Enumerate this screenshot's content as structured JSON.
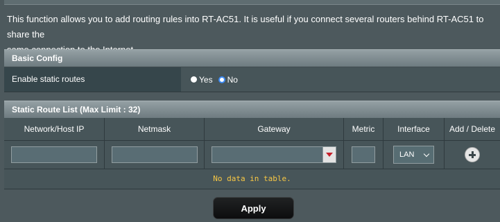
{
  "intro": {
    "line1": "This function allows you to add routing rules into RT-AC51. It is useful if you connect several routers behind RT-AC51 to share the",
    "line2": "same connection to the Internet."
  },
  "basic_config": {
    "title": "Basic Config",
    "static_routes_label": "Enable static routes",
    "options": [
      {
        "label": "Yes",
        "selected": false
      },
      {
        "label": "No",
        "selected": true
      }
    ]
  },
  "route_list": {
    "title": "Static Route List (Max Limit : 32)",
    "columns": [
      "Network/Host IP",
      "Netmask",
      "Gateway",
      "Metric",
      "Interface",
      "Add / Delete"
    ],
    "inputs": {
      "network_ip": "",
      "netmask": "",
      "gateway": "",
      "metric": "",
      "interface": "LAN"
    },
    "empty_message": "No data in table."
  },
  "apply_label": "Apply",
  "colors": {
    "background": "#4d595d",
    "accent_yellow": "#f7c744",
    "radio_blue": "#3d8bf5"
  }
}
